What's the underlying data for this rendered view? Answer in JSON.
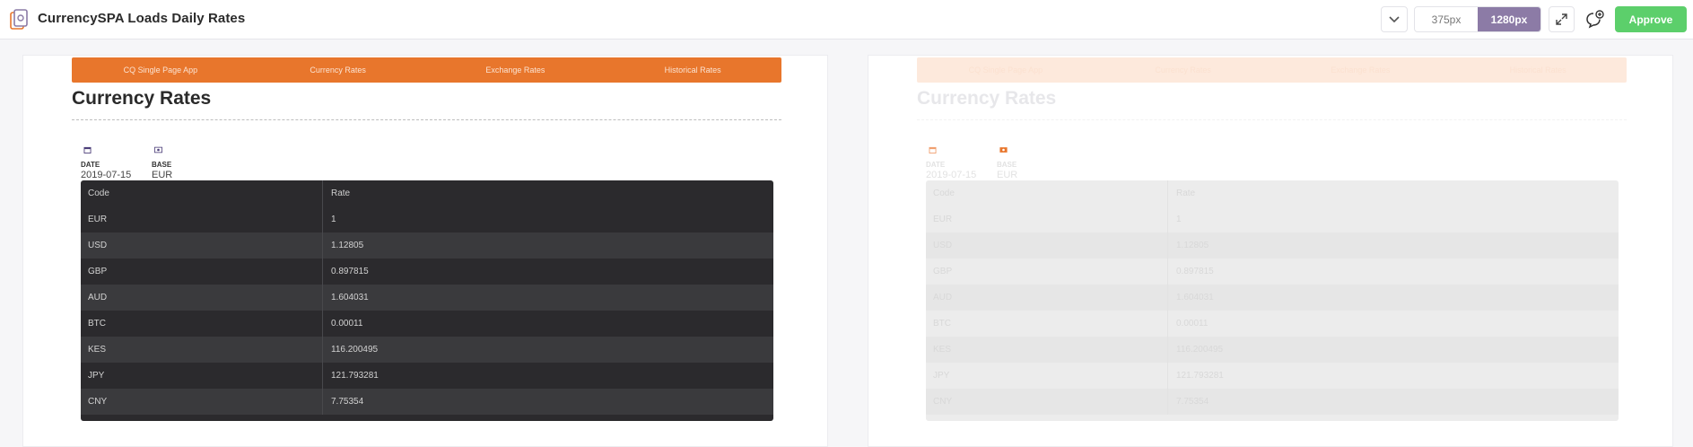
{
  "header": {
    "title": "CurrencySPA Loads Daily Rates",
    "viewports": [
      "375px",
      "1280px"
    ],
    "active_viewport": "1280px",
    "approve_label": "Approve"
  },
  "page": {
    "nav": [
      "CQ Single Page App",
      "Currency Rates",
      "Exchange Rates",
      "Historical Rates"
    ],
    "title": "Currency Rates",
    "date_label": "DATE",
    "date_value": "2019-07-15",
    "base_label": "BASE",
    "base_value": "EUR",
    "table": {
      "headers": [
        "Code",
        "Rate"
      ],
      "rows": [
        [
          "EUR",
          "1"
        ],
        [
          "USD",
          "1.12805"
        ],
        [
          "GBP",
          "0.897815"
        ],
        [
          "AUD",
          "1.604031"
        ],
        [
          "BTC",
          "0.00011"
        ],
        [
          "KES",
          "116.200495"
        ],
        [
          "JPY",
          "121.793281"
        ],
        [
          "CNY",
          "7.75354"
        ]
      ]
    }
  },
  "colors": {
    "brand_orange": "#e8762c",
    "approve_green": "#5ccf6b",
    "active_viewport_purple": "#8c7ba6",
    "table_dark": "#2b2a2d"
  }
}
